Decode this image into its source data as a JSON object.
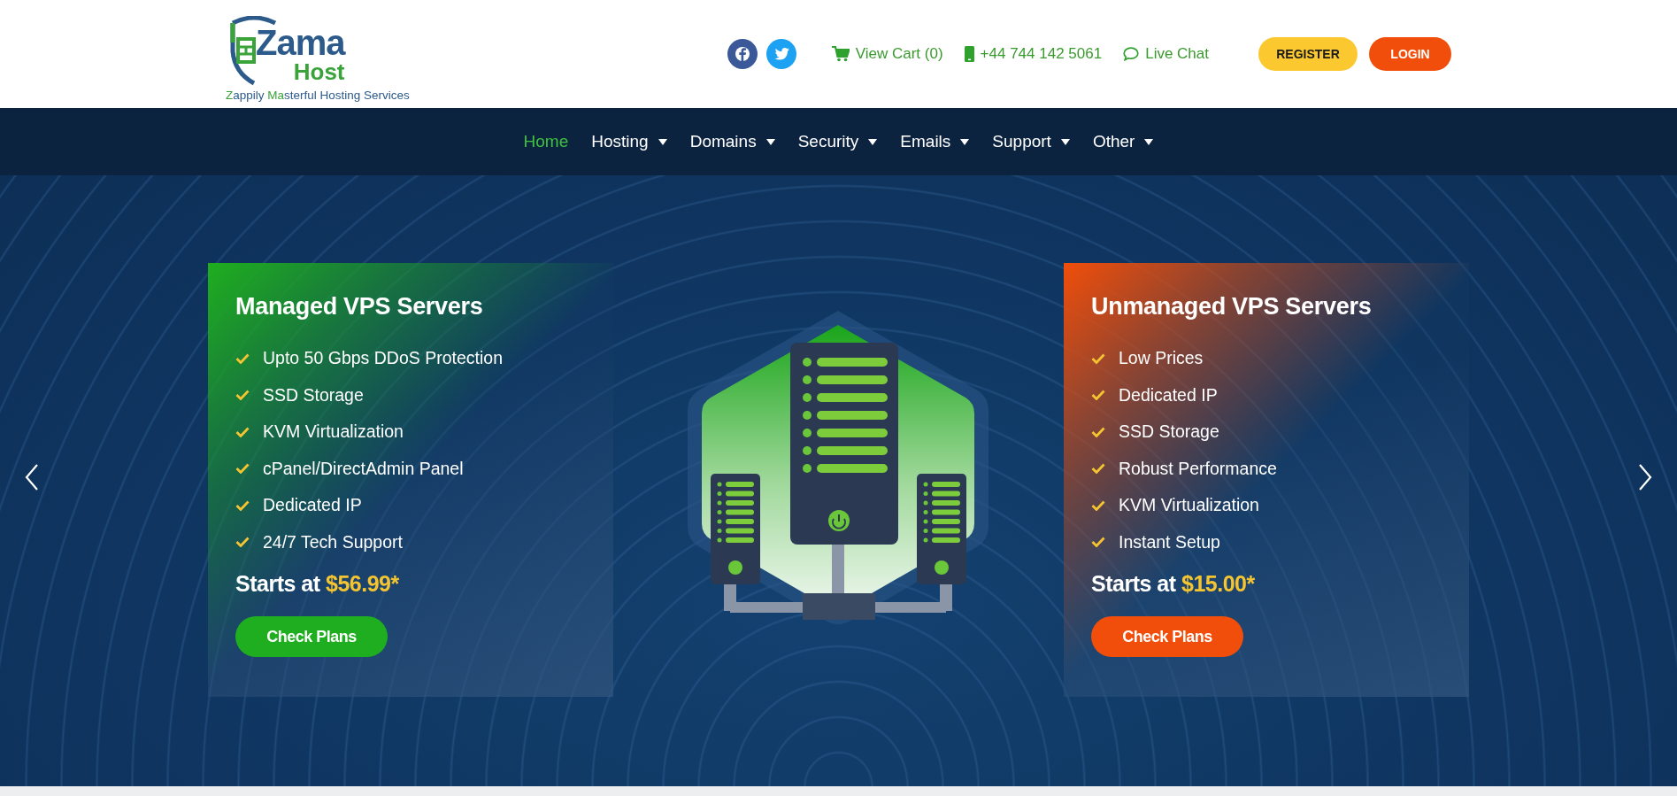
{
  "logo": {
    "word_main": "Zama",
    "word_sub": "Host",
    "tagline": [
      {
        "text": "Z",
        "accent": true
      },
      {
        "text": "appily ",
        "accent": false
      },
      {
        "text": "Ma",
        "accent": true
      },
      {
        "text": "sterful Hosting Services",
        "accent": false
      }
    ]
  },
  "header": {
    "social": [
      {
        "kind": "facebook"
      },
      {
        "kind": "twitter"
      }
    ],
    "contacts": [
      {
        "kind": "cart",
        "label": "View Cart (0)"
      },
      {
        "kind": "phone",
        "label": "+44 744 142 5061"
      },
      {
        "kind": "chat",
        "label": "Live Chat"
      }
    ],
    "buttons": [
      {
        "kind": "register",
        "label": "REGISTER"
      },
      {
        "kind": "login",
        "label": "LOGIN"
      }
    ]
  },
  "nav": [
    {
      "label": "Home",
      "selected": true,
      "has_menu": false
    },
    {
      "label": "Hosting",
      "selected": false,
      "has_menu": true
    },
    {
      "label": "Domains",
      "selected": false,
      "has_menu": true
    },
    {
      "label": "Security",
      "selected": false,
      "has_menu": true
    },
    {
      "label": "Emails",
      "selected": false,
      "has_menu": true
    },
    {
      "label": "Support",
      "selected": false,
      "has_menu": true
    },
    {
      "label": "Other",
      "selected": false,
      "has_menu": true
    }
  ],
  "plans": [
    {
      "color": "#1fae1f",
      "title": "Managed VPS Servers",
      "features": [
        "Upto 50 Gbps DDoS Protection",
        "SSD Storage",
        "KVM Virtualization",
        "cPanel/DirectAdmin Panel",
        "Dedicated IP",
        "24/7 Tech Support"
      ],
      "price_label": "Starts at",
      "price": "$56.99*",
      "button": "Check Plans"
    },
    {
      "color": "#f04e0a",
      "title": "Unmanaged VPS Servers",
      "features": [
        "Low Prices",
        "Dedicated IP",
        "SSD Storage",
        "Robust Performance",
        "KVM Virtualization",
        "Instant Setup"
      ],
      "price_label": "Starts at",
      "price": "$15.00*",
      "button": "Check Plans"
    }
  ]
}
